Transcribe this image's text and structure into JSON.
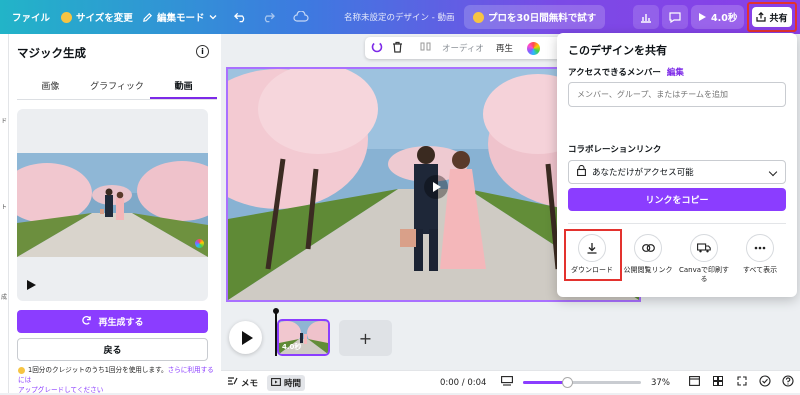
{
  "topbar": {
    "file": "ファイル",
    "resize": "サイズを変更",
    "edit_mode": "編集モード",
    "doc_title": "名称未設定のデザイン - 動画",
    "pro_trial": "プロを30日間無料で試す",
    "duration_btn": "4.0秒",
    "share": "共有"
  },
  "left_rail": {
    "marks": [
      "ド",
      "ト",
      "成"
    ]
  },
  "left_panel": {
    "title": "マジック生成",
    "tabs": [
      "画像",
      "グラフィック",
      "動画"
    ],
    "active_tab": "動画",
    "regenerate": "再生成する",
    "back": "戻る",
    "credit_text": "1回分のクレジットのうち1回分を使用します。",
    "credit_link": "さらに利用するには",
    "credit_upgrade": "アップグレードしてください"
  },
  "float_toolbar": {
    "audio": "オーディオ",
    "play": "再生"
  },
  "timeline": {
    "thumb_duration": "4.0秒",
    "add": "+"
  },
  "bottombar": {
    "memo": "メモ",
    "time": "時間",
    "timecode": "0:00 / 0:04",
    "zoom": "37%",
    "zoom_level": 0.37
  },
  "share_panel": {
    "title": "このデザインを共有",
    "members_label": "アクセスできるメンバー",
    "members_edit": "編集",
    "members_placeholder": "メンバー、グループ、またはチームを追加",
    "collab_label": "コラボレーションリンク",
    "access_value": "あなただけがアクセス可能",
    "copy_link": "リンクをコピー",
    "options": [
      {
        "label": "ダウンロード",
        "icon": "download-icon"
      },
      {
        "label": "公開閲覧リンク",
        "icon": "link-icon"
      },
      {
        "label": "Canvaで印刷する",
        "icon": "truck-icon"
      },
      {
        "label": "すべて表示",
        "icon": "more-icon"
      }
    ]
  },
  "colors": {
    "accent": "#8b3dff",
    "highlight": "#e3322e"
  }
}
